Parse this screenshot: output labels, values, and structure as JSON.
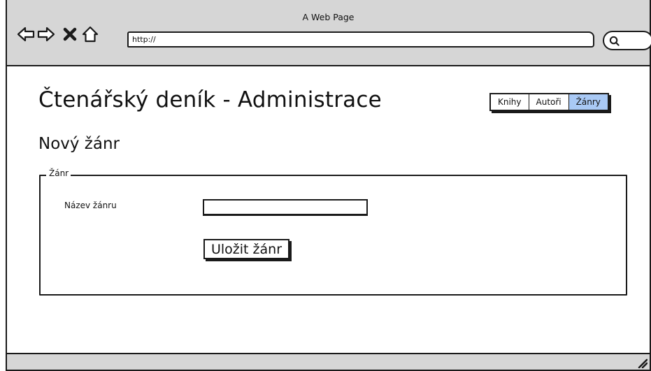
{
  "window": {
    "title": "A Web Page"
  },
  "toolbar": {
    "back_icon": "arrow-left-icon",
    "forward_icon": "arrow-right-icon",
    "stop_icon": "close-icon",
    "home_icon": "home-icon",
    "search_icon": "search-icon"
  },
  "address_bar": {
    "value": "http://"
  },
  "header": {
    "title": "Čtenářský deník - Administrace",
    "tabs": [
      {
        "label": "Knihy",
        "active": false
      },
      {
        "label": "Autoři",
        "active": false
      },
      {
        "label": "Žánry",
        "active": true
      }
    ]
  },
  "form": {
    "heading": "Nový žánr",
    "legend": "Žánr",
    "name_label": "Název žánru",
    "name_value": "",
    "submit_label": "Uložit žánr"
  },
  "colors": {
    "chrome": "#d6d6d6",
    "active_tab": "#a9c9f5",
    "border": "#1a1a1a"
  }
}
